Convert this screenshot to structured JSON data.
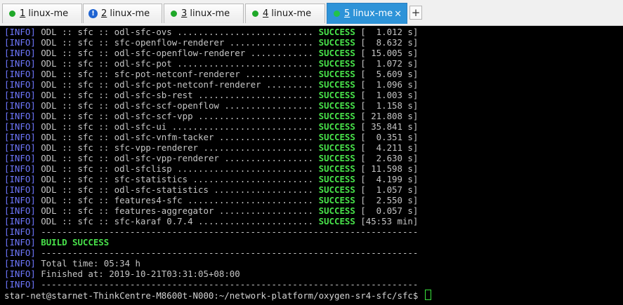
{
  "tabs": [
    {
      "num": "1",
      "title": " linux-me",
      "status": "ok",
      "active": false
    },
    {
      "num": "2",
      "title": " linux-me",
      "status": "warn",
      "active": false
    },
    {
      "num": "3",
      "title": " linux-me",
      "status": "ok",
      "active": false
    },
    {
      "num": "4",
      "title": " linux-me",
      "status": "ok",
      "active": false
    },
    {
      "num": "5",
      "title": " linux-me",
      "status": "ok",
      "active": true
    }
  ],
  "new_tab_label": "+",
  "close_label": "×",
  "warn_glyph": "!",
  "terminal": {
    "lines": [
      {
        "tag": "[INFO]",
        "text": " ODL :: sfc :: odl-sfc-ovs .......................... ",
        "status": "SUCCESS",
        "time": " [  1.012 s]"
      },
      {
        "tag": "[INFO]",
        "text": " ODL :: sfc :: sfc-openflow-renderer ................ ",
        "status": "SUCCESS",
        "time": " [  8.632 s]"
      },
      {
        "tag": "[INFO]",
        "text": " ODL :: sfc :: odl-sfc-openflow-renderer ............ ",
        "status": "SUCCESS",
        "time": " [ 15.005 s]"
      },
      {
        "tag": "[INFO]",
        "text": " ODL :: sfc :: odl-sfc-pot .......................... ",
        "status": "SUCCESS",
        "time": " [  1.072 s]"
      },
      {
        "tag": "[INFO]",
        "text": " ODL :: sfc :: sfc-pot-netconf-renderer ............. ",
        "status": "SUCCESS",
        "time": " [  5.609 s]"
      },
      {
        "tag": "[INFO]",
        "text": " ODL :: sfc :: odl-sfc-pot-netconf-renderer ......... ",
        "status": "SUCCESS",
        "time": " [  1.096 s]"
      },
      {
        "tag": "[INFO]",
        "text": " ODL :: sfc :: odl-sfc-sb-rest ...................... ",
        "status": "SUCCESS",
        "time": " [  1.003 s]"
      },
      {
        "tag": "[INFO]",
        "text": " ODL :: sfc :: odl-sfc-scf-openflow ................. ",
        "status": "SUCCESS",
        "time": " [  1.158 s]"
      },
      {
        "tag": "[INFO]",
        "text": " ODL :: sfc :: odl-sfc-scf-vpp ...................... ",
        "status": "SUCCESS",
        "time": " [ 21.808 s]"
      },
      {
        "tag": "[INFO]",
        "text": " ODL :: sfc :: odl-sfc-ui ........................... ",
        "status": "SUCCESS",
        "time": " [ 35.841 s]"
      },
      {
        "tag": "[INFO]",
        "text": " ODL :: sfc :: odl-sfc-vnfm-tacker .................. ",
        "status": "SUCCESS",
        "time": " [  0.351 s]"
      },
      {
        "tag": "[INFO]",
        "text": " ODL :: sfc :: sfc-vpp-renderer ..................... ",
        "status": "SUCCESS",
        "time": " [  4.211 s]"
      },
      {
        "tag": "[INFO]",
        "text": " ODL :: sfc :: odl-sfc-vpp-renderer ................. ",
        "status": "SUCCESS",
        "time": " [  2.630 s]"
      },
      {
        "tag": "[INFO]",
        "text": " ODL :: sfc :: odl-sfclisp .......................... ",
        "status": "SUCCESS",
        "time": " [ 11.598 s]"
      },
      {
        "tag": "[INFO]",
        "text": " ODL :: sfc :: sfc-statistics ....................... ",
        "status": "SUCCESS",
        "time": " [  4.199 s]"
      },
      {
        "tag": "[INFO]",
        "text": " ODL :: sfc :: odl-sfc-statistics ................... ",
        "status": "SUCCESS",
        "time": " [  1.057 s]"
      },
      {
        "tag": "[INFO]",
        "text": " ODL :: sfc :: features4-sfc ........................ ",
        "status": "SUCCESS",
        "time": " [  2.550 s]"
      },
      {
        "tag": "[INFO]",
        "text": " ODL :: sfc :: features-aggregator .................. ",
        "status": "SUCCESS",
        "time": " [  0.057 s]"
      },
      {
        "tag": "[INFO]",
        "text": " ODL :: sfc :: sfc-karaf 0.7.4 ...................... ",
        "status": "SUCCESS",
        "time": " [45:53 min]"
      },
      {
        "tag": "[INFO]",
        "text": " ------------------------------------------------------------------------"
      },
      {
        "tag": "[INFO]",
        "text": " ",
        "status": "BUILD SUCCESS"
      },
      {
        "tag": "[INFO]",
        "text": " ------------------------------------------------------------------------"
      },
      {
        "tag": "[INFO]",
        "text": " Total time: 05:34 h"
      },
      {
        "tag": "[INFO]",
        "text": " Finished at: 2019-10-21T03:31:05+08:00"
      },
      {
        "tag": "[INFO]",
        "text": " ------------------------------------------------------------------------"
      }
    ],
    "prompt": "star-net@starnet-ThinkCentre-M8600t-N000:~/network-platform/oxygen-sr4-sfc/sfc$ "
  },
  "colors": {
    "tag": "#6f78ff",
    "success": "#48e24a",
    "text": "#c5c5c5",
    "background": "#000000",
    "active_tab": "#2e93d8"
  }
}
